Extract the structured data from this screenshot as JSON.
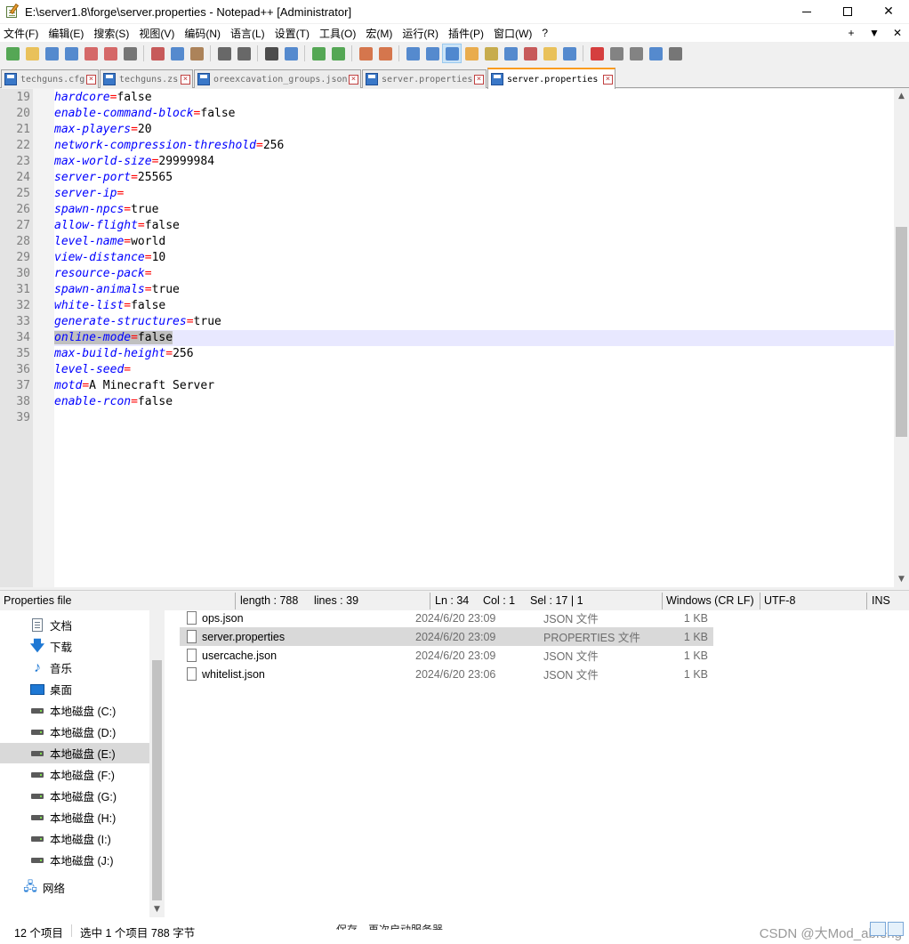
{
  "window": {
    "title": "E:\\server1.8\\forge\\server.properties - Notepad++ [Administrator]"
  },
  "menu": [
    "文件(F)",
    "编辑(E)",
    "搜索(S)",
    "视图(V)",
    "编码(N)",
    "语言(L)",
    "设置(T)",
    "工具(O)",
    "宏(M)",
    "运行(R)",
    "插件(P)",
    "窗口(W)",
    "?"
  ],
  "menu_right": [
    "+",
    "▼",
    "✕"
  ],
  "toolbar": [
    {
      "icon": "new-file-icon",
      "color": "#3a9a3a"
    },
    {
      "icon": "open-file-icon",
      "color": "#e8b840"
    },
    {
      "icon": "save-icon",
      "color": "#3a78c8"
    },
    {
      "icon": "save-all-icon",
      "color": "#3a78c8"
    },
    {
      "icon": "close-icon",
      "color": "#d05050"
    },
    {
      "icon": "close-all-icon",
      "color": "#d05050"
    },
    {
      "icon": "print-icon",
      "color": "#606060"
    },
    {
      "sep": true
    },
    {
      "icon": "cut-icon",
      "color": "#c04040"
    },
    {
      "icon": "copy-icon",
      "color": "#3a78c8"
    },
    {
      "icon": "paste-icon",
      "color": "#a07040"
    },
    {
      "sep": true
    },
    {
      "icon": "undo-icon",
      "color": "#505050"
    },
    {
      "icon": "redo-icon",
      "color": "#505050"
    },
    {
      "sep": true
    },
    {
      "icon": "find-icon",
      "color": "#303030"
    },
    {
      "icon": "replace-icon",
      "color": "#3a78c8"
    },
    {
      "sep": true
    },
    {
      "icon": "zoom-in-icon",
      "color": "#3a9a3a"
    },
    {
      "icon": "zoom-out-icon",
      "color": "#3a9a3a"
    },
    {
      "sep": true
    },
    {
      "icon": "sync-vertical-icon",
      "color": "#d06030"
    },
    {
      "icon": "sync-horizontal-icon",
      "color": "#d06030"
    },
    {
      "sep": true
    },
    {
      "icon": "word-wrap-icon",
      "color": "#3a78c8"
    },
    {
      "icon": "show-all-chars-icon",
      "color": "#3a78c8"
    },
    {
      "icon": "indent-guide-icon",
      "color": "#3a78c8",
      "active": true
    },
    {
      "icon": "udl-icon",
      "color": "#e8a030"
    },
    {
      "icon": "doc-map-icon",
      "color": "#c0a030"
    },
    {
      "icon": "doc-list-icon",
      "color": "#3a78c8"
    },
    {
      "icon": "function-list-icon",
      "color": "#c04040"
    },
    {
      "icon": "folder-workspace-icon",
      "color": "#e8b840"
    },
    {
      "icon": "monitoring-icon",
      "color": "#3a78c8"
    },
    {
      "sep": true
    },
    {
      "icon": "record-macro-icon",
      "color": "#d02020"
    },
    {
      "icon": "stop-record-icon",
      "color": "#707070"
    },
    {
      "icon": "play-macro-icon",
      "color": "#707070"
    },
    {
      "icon": "run-macro-multiple-icon",
      "color": "#3a78c8"
    },
    {
      "icon": "save-macro-icon",
      "color": "#606060"
    }
  ],
  "tabs": [
    {
      "label": "techguns.cfg",
      "active": false
    },
    {
      "label": "techguns.zs",
      "active": false
    },
    {
      "label": "oreexcavation_groups.json",
      "active": false
    },
    {
      "label": "server.properties",
      "active": false
    },
    {
      "label": "server.properties",
      "active": true
    }
  ],
  "editor": {
    "lines": [
      {
        "n": "19",
        "key": "hardcore",
        "value": "false"
      },
      {
        "n": "20",
        "key": "enable-command-block",
        "value": "false"
      },
      {
        "n": "21",
        "key": "max-players",
        "value": "20"
      },
      {
        "n": "22",
        "key": "network-compression-threshold",
        "value": "256"
      },
      {
        "n": "23",
        "key": "max-world-size",
        "value": "29999984"
      },
      {
        "n": "24",
        "key": "server-port",
        "value": "25565"
      },
      {
        "n": "25",
        "key": "server-ip",
        "value": ""
      },
      {
        "n": "26",
        "key": "spawn-npcs",
        "value": "true"
      },
      {
        "n": "27",
        "key": "allow-flight",
        "value": "false"
      },
      {
        "n": "28",
        "key": "level-name",
        "value": "world"
      },
      {
        "n": "29",
        "key": "view-distance",
        "value": "10"
      },
      {
        "n": "30",
        "key": "resource-pack",
        "value": ""
      },
      {
        "n": "31",
        "key": "spawn-animals",
        "value": "true"
      },
      {
        "n": "32",
        "key": "white-list",
        "value": "false"
      },
      {
        "n": "33",
        "key": "generate-structures",
        "value": "true"
      },
      {
        "n": "34",
        "key": "online-mode",
        "value": "false",
        "current": true,
        "selected": true
      },
      {
        "n": "35",
        "key": "max-build-height",
        "value": "256"
      },
      {
        "n": "36",
        "key": "level-seed",
        "value": ""
      },
      {
        "n": "37",
        "key": "motd",
        "value": "A Minecraft Server"
      },
      {
        "n": "38",
        "key": "enable-rcon",
        "value": "false"
      },
      {
        "n": "39",
        "key": "",
        "value": "",
        "empty": true
      }
    ]
  },
  "statusbar": {
    "filetype": "Properties file",
    "length": "length : 788",
    "lines": "lines : 39",
    "ln": "Ln : 34",
    "col": "Col : 1",
    "sel": "Sel : 17 | 1",
    "eol": "Windows (CR LF)",
    "encoding": "UTF-8",
    "mode": "INS"
  },
  "explorer": {
    "nav": [
      {
        "label": "文档",
        "icon": "documents-icon"
      },
      {
        "label": "下载",
        "icon": "downloads-icon"
      },
      {
        "label": "音乐",
        "icon": "music-icon"
      },
      {
        "label": "桌面",
        "icon": "desktop-icon"
      },
      {
        "label": "本地磁盘 (C:)",
        "icon": "drive-icon"
      },
      {
        "label": "本地磁盘 (D:)",
        "icon": "drive-icon"
      },
      {
        "label": "本地磁盘 (E:)",
        "icon": "drive-icon",
        "selected": true
      },
      {
        "label": "本地磁盘 (F:)",
        "icon": "drive-icon"
      },
      {
        "label": "本地磁盘 (G:)",
        "icon": "drive-icon"
      },
      {
        "label": "本地磁盘 (H:)",
        "icon": "drive-icon"
      },
      {
        "label": "本地磁盘 (I:)",
        "icon": "drive-icon"
      },
      {
        "label": "本地磁盘 (J:)",
        "icon": "drive-icon"
      },
      {
        "label": "网络",
        "icon": "network-icon"
      }
    ],
    "files": [
      {
        "name": "ops.json",
        "date": "2024/6/20 23:09",
        "type": "JSON 文件",
        "size": "1 KB"
      },
      {
        "name": "server.properties",
        "date": "2024/6/20 23:09",
        "type": "PROPERTIES 文件",
        "size": "1 KB",
        "selected": true
      },
      {
        "name": "usercache.json",
        "date": "2024/6/20 23:09",
        "type": "JSON 文件",
        "size": "1 KB"
      },
      {
        "name": "whitelist.json",
        "date": "2024/6/20 23:06",
        "type": "JSON 文件",
        "size": "1 KB"
      }
    ],
    "status": {
      "count": "12 个项目",
      "selection": "选中 1 个项目  788 字节"
    },
    "watermark": "CSDN @大Mod_abfeng",
    "bottom_text": "保存，再次启动服务器"
  }
}
